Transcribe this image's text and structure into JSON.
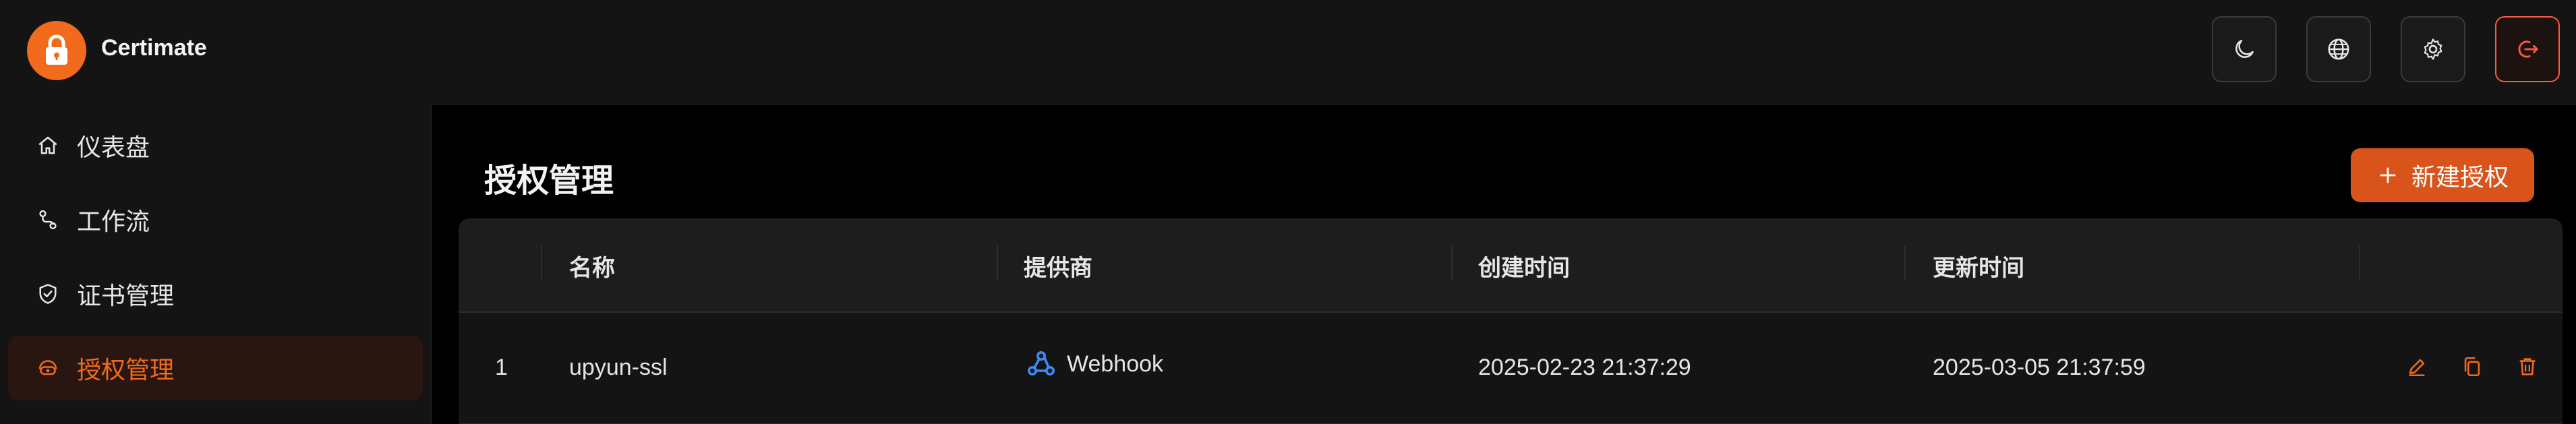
{
  "app": {
    "name": "Certimate",
    "colors": {
      "accent": "#f26a1b",
      "danger": "#ff5a3c",
      "bg": "#000000",
      "panel": "#141414"
    }
  },
  "header": {
    "buttons": [
      {
        "id": "theme",
        "icon": "moon-icon"
      },
      {
        "id": "language",
        "icon": "globe-icon"
      },
      {
        "id": "settings",
        "icon": "gear-icon"
      },
      {
        "id": "logout",
        "icon": "logout-icon"
      }
    ]
  },
  "sidebar": {
    "items": [
      {
        "label": "仪表盘",
        "icon": "home-icon"
      },
      {
        "label": "工作流",
        "icon": "workflow-icon"
      },
      {
        "label": "证书管理",
        "icon": "shield-icon"
      },
      {
        "label": "授权管理",
        "icon": "access-icon",
        "active": true
      }
    ]
  },
  "main": {
    "title": "授权管理",
    "new_button_label": "新建授权",
    "table": {
      "headers": [
        "",
        "名称",
        "提供商",
        "创建时间",
        "更新时间",
        ""
      ],
      "rows": [
        {
          "index": "1",
          "name": "upyun-ssl",
          "provider": "Webhook",
          "created": "2025-02-23 21:37:29",
          "updated": "2025-03-05 21:37:59",
          "actions": [
            "edit-icon",
            "copy-icon",
            "delete-icon"
          ]
        }
      ]
    }
  }
}
